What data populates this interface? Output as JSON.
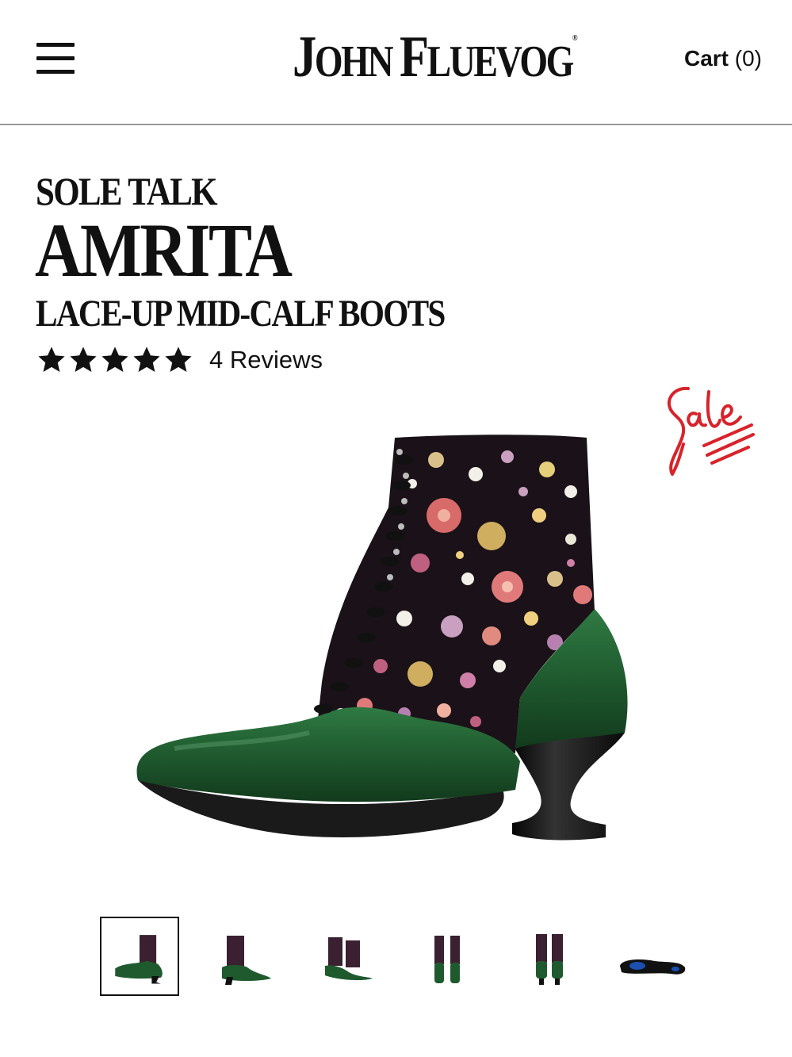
{
  "header": {
    "menu_icon": "hamburger-menu-icon",
    "logo": {
      "first_initial": "J",
      "first_rest": "OHN",
      "last_initial": "F",
      "last_rest": "LUEVOG",
      "mark": "®"
    },
    "cart_label": "Cart",
    "cart_count": "(0)"
  },
  "product": {
    "collection": "SOLE TALK",
    "name": "AMRITA",
    "subtitle": "LACE-UP MID-CALF BOOTS",
    "rating": 5,
    "reviews": "4 Reviews",
    "sale_badge": "Sale"
  },
  "gallery": {
    "thumbnail_count": 6,
    "active_index": 0
  },
  "colors": {
    "leather": "#1f5a2e",
    "sole": "#1a1a1a",
    "sale": "#d8232a",
    "divider": "#9a9a9a"
  }
}
